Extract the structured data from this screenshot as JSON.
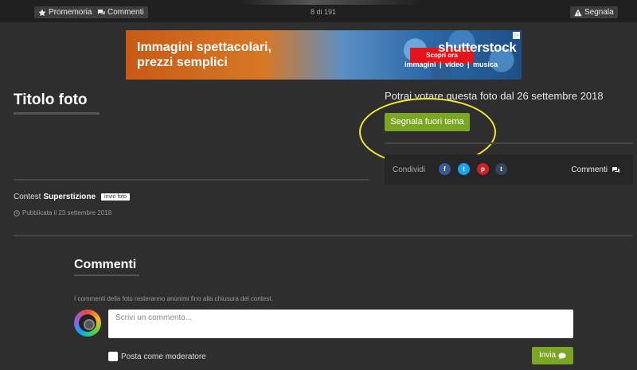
{
  "topbar": {
    "reminder_label": "Promemoria",
    "comments_label": "Commenti",
    "counter": "8 di 191",
    "report_label": "Segnala"
  },
  "ad": {
    "headline_1": "Immagini spettacolari,",
    "headline_2": "prezzi semplici",
    "cta": "Scopri ora",
    "brand": "shutterstock",
    "sub": "immagini | video | musica"
  },
  "photo": {
    "title": "Titolo foto",
    "vote_message": "Potrai votare questa foto dal 26 settembre 2018",
    "report_off_topic": "Segnala fuori tema"
  },
  "share": {
    "label": "Condividi",
    "networks": [
      {
        "icon": "facebook-icon",
        "glyph": "f",
        "color": "#3b5998"
      },
      {
        "icon": "twitter-icon",
        "glyph": "t",
        "color": "#1da1f2"
      },
      {
        "icon": "pinterest-icon",
        "glyph": "p",
        "color": "#cb2027"
      },
      {
        "icon": "tumblr-icon",
        "glyph": "t",
        "color": "#35465c"
      }
    ],
    "comments_label": "Commenti"
  },
  "contest": {
    "prefix": "Contest",
    "name": "Superstizione",
    "tag": "invio foto",
    "published": "Pubblicata il 23 settembre 2018"
  },
  "comments": {
    "title": "Commenti",
    "note": "I commenti della foto resteranno anonimi fino alla chiusura del contest.",
    "placeholder": "Scrivi un commento...",
    "moderator_label": "Posta come moderatore",
    "send_label": "Invia"
  },
  "colors": {
    "accent_green": "#7aa623",
    "background": "#2e2e2e",
    "highlight_circle": "#f2ea2c"
  }
}
